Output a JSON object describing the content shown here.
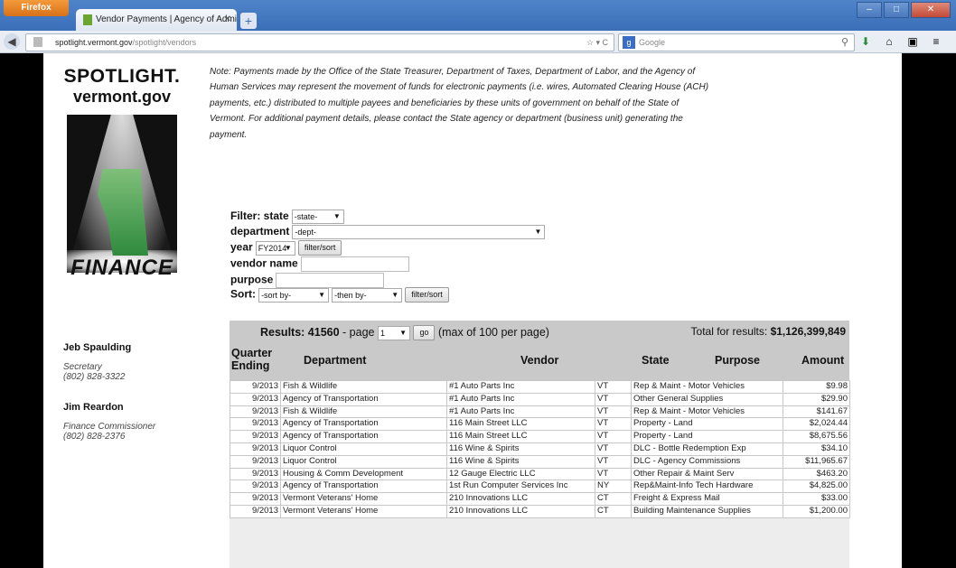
{
  "browser": {
    "menu_label": "Firefox",
    "tab_title": "Vendor Payments | Agency of Administr...",
    "url_domain": "spotlight.vermont.gov",
    "url_path": "/spotlight/vendors",
    "search_placeholder": "Google"
  },
  "logo": {
    "line1": "SPOTLIGHT.",
    "line2": "vermont.gov",
    "finance": "FINANCE"
  },
  "note": "Note: Payments made by the Office of the State Treasurer, Department of Taxes, Department of Labor, and the Agency of Human Services may represent the movement of funds for electronic payments (i.e. wires, Automated Clearing House (ACH) payments, etc.) distributed to multiple payees and beneficiaries by these units of government on behalf of the State of Vermont. For additional payment details, please contact the State agency or department (business unit) generating the payment.",
  "filters": {
    "filter_label": "Filter: state",
    "state_value": "-state-",
    "department_label": "department",
    "department_value": "-dept-",
    "year_label": "year",
    "year_value": "FY2014",
    "filter_sort_btn": "filter/sort",
    "vendor_label": "vendor name",
    "purpose_label": "purpose",
    "sort_label": "Sort:",
    "sort_by_value": "-sort by-",
    "then_by_value": "-then by-",
    "filter_sort_btn2": "filter/sort"
  },
  "contacts": [
    {
      "name": "Jeb Spaulding",
      "title": "Secretary",
      "phone": "(802) 828-3322"
    },
    {
      "name": "Jim Reardon",
      "title": "Finance Commissioner",
      "phone": "(802) 828-2376"
    }
  ],
  "results": {
    "results_label": "Results: 41560",
    "page_label": "- page",
    "page_value": "1",
    "go_btn": "go",
    "max_label": "(max of 100 per page)",
    "total_label": "Total for results:",
    "total_value": "$1,126,399,849"
  },
  "columns": {
    "quarter": "Quarter Ending",
    "department": "Department",
    "vendor": "Vendor",
    "state": "State",
    "purpose": "Purpose",
    "amount": "Amount"
  },
  "rows": [
    {
      "q": "9/2013",
      "dept": "Fish & Wildlife",
      "vendor": "#1 Auto Parts Inc",
      "state": "VT",
      "purpose": "Rep & Maint - Motor Vehicles",
      "amount": "$9.98"
    },
    {
      "q": "9/2013",
      "dept": "Agency of Transportation",
      "vendor": "#1 Auto Parts Inc",
      "state": "VT",
      "purpose": "Other General Supplies",
      "amount": "$29.90"
    },
    {
      "q": "9/2013",
      "dept": "Fish & Wildlife",
      "vendor": "#1 Auto Parts Inc",
      "state": "VT",
      "purpose": "Rep & Maint - Motor Vehicles",
      "amount": "$141.67"
    },
    {
      "q": "9/2013",
      "dept": "Agency of Transportation",
      "vendor": "116 Main Street LLC",
      "state": "VT",
      "purpose": "Property - Land",
      "amount": "$2,024.44"
    },
    {
      "q": "9/2013",
      "dept": "Agency of Transportation",
      "vendor": "116 Main Street LLC",
      "state": "VT",
      "purpose": "Property - Land",
      "amount": "$8,675.56"
    },
    {
      "q": "9/2013",
      "dept": "Liquor Control",
      "vendor": "116 Wine & Spirits",
      "state": "VT",
      "purpose": "DLC - Bottle Redemption Exp",
      "amount": "$34.10"
    },
    {
      "q": "9/2013",
      "dept": "Liquor Control",
      "vendor": "116 Wine & Spirits",
      "state": "VT",
      "purpose": "DLC - Agency Commissions",
      "amount": "$11,965.67"
    },
    {
      "q": "9/2013",
      "dept": "Housing & Comm Development",
      "vendor": "12 Gauge Electric LLC",
      "state": "VT",
      "purpose": "Other Repair & Maint Serv",
      "amount": "$463.20"
    },
    {
      "q": "9/2013",
      "dept": "Agency of Transportation",
      "vendor": "1st Run Computer Services Inc",
      "state": "NY",
      "purpose": "Rep&Maint-Info Tech Hardware",
      "amount": "$4,825.00"
    },
    {
      "q": "9/2013",
      "dept": "Vermont Veterans' Home",
      "vendor": "210 Innovations LLC",
      "state": "CT",
      "purpose": "Freight & Express Mail",
      "amount": "$33.00"
    },
    {
      "q": "9/2013",
      "dept": "Vermont Veterans' Home",
      "vendor": "210 Innovations LLC",
      "state": "CT",
      "purpose": "Building Maintenance Supplies",
      "amount": "$1,200.00"
    }
  ]
}
